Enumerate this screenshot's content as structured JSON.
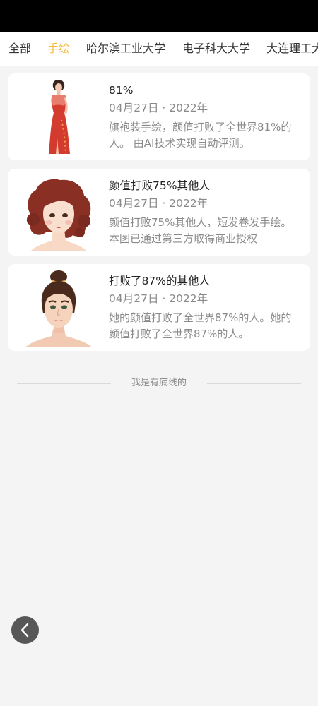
{
  "tabs": [
    {
      "label": "全部",
      "active": false
    },
    {
      "label": "手绘",
      "active": true
    },
    {
      "label": "哈尔滨工业大学",
      "active": false
    },
    {
      "label": "电子科大大学",
      "active": false
    },
    {
      "label": "大连理工大学",
      "active": false
    }
  ],
  "colors": {
    "accent": "#f5b83d",
    "status_bar": "#000000",
    "background": "#f4f4f4",
    "card": "#ffffff",
    "text_primary": "#222222",
    "text_secondary": "#8a8a8a",
    "back_button": "#575757"
  },
  "articles": [
    {
      "title": "81%",
      "date": "04月27日 · 2022年",
      "description": "旗袍装手绘，颜值打败了全世界81%的人。 由AI技术实现自动评测。",
      "thumbnail": "qipao-woman-illustration"
    },
    {
      "title": "颜值打败75%其他人",
      "date": "04月27日 · 2022年",
      "description": "颜值打败75%其他人，短发卷发手绘。本图已通过第三方取得商业授权",
      "thumbnail": "curly-hair-woman-illustration"
    },
    {
      "title": "打败了87%的其他人",
      "date": "04月27日 · 2022年",
      "description": "她的颜值打败了全世界87%的人。她的颜值打败了全世界87%的人。",
      "thumbnail": "bun-hair-woman-illustration"
    }
  ],
  "footer": {
    "text": "我是有底线的"
  },
  "back_button": {
    "icon": "chevron-left-icon"
  }
}
